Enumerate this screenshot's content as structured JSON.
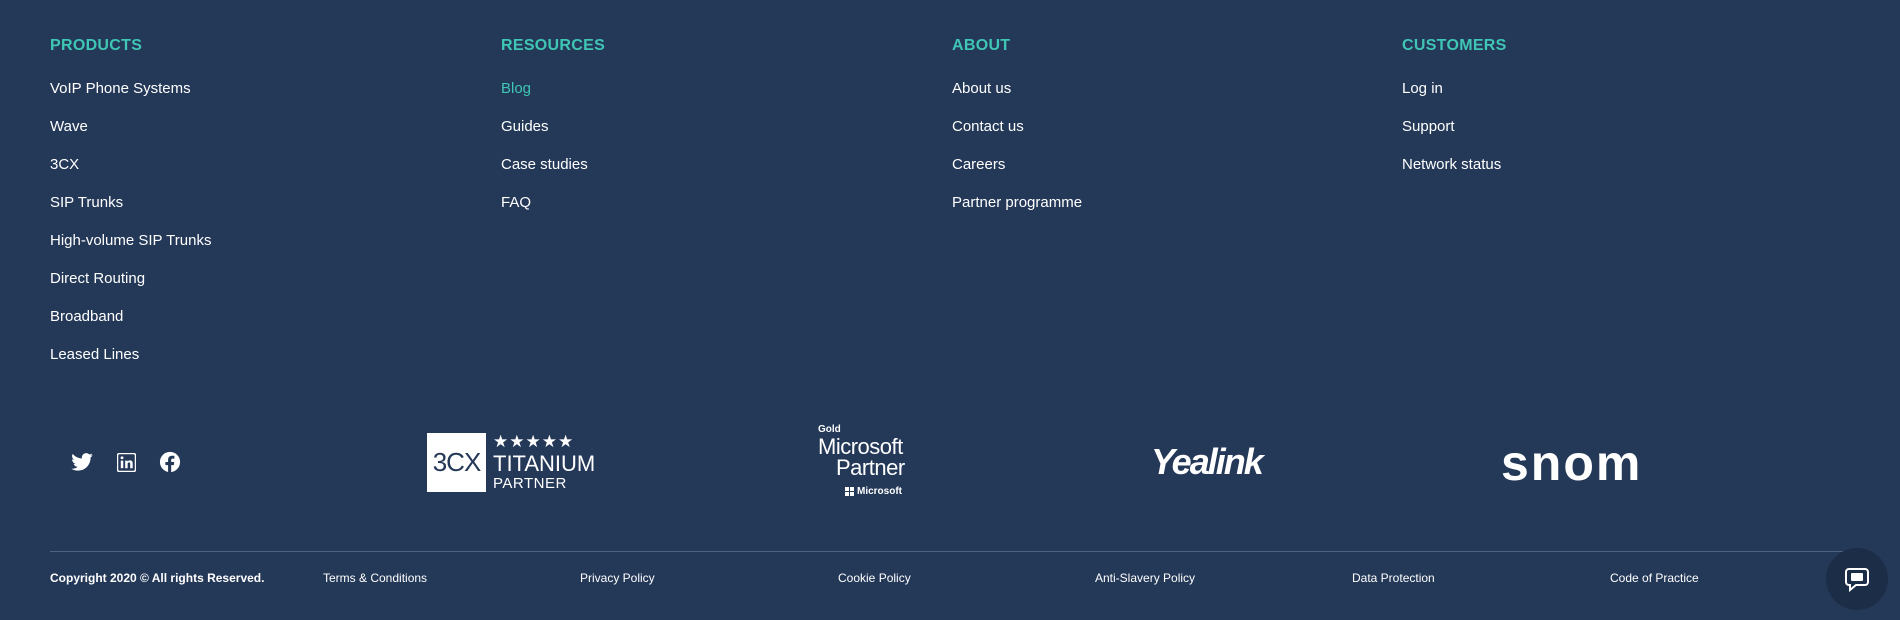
{
  "columns": [
    {
      "heading": "PRODUCTS",
      "links": [
        "VoIP Phone Systems",
        "Wave",
        "3CX",
        "SIP Trunks",
        "High-volume SIP Trunks",
        "Direct Routing",
        "Broadband",
        "Leased Lines"
      ]
    },
    {
      "heading": "RESOURCES",
      "links": [
        "Blog",
        "Guides",
        "Case studies",
        "FAQ"
      ]
    },
    {
      "heading": "ABOUT",
      "links": [
        "About us",
        "Contact us",
        "Careers",
        "Partner programme"
      ]
    },
    {
      "heading": "CUSTOMERS",
      "links": [
        "Log in",
        "Support",
        "Network status"
      ]
    }
  ],
  "social": {
    "icons": [
      "twitter-icon",
      "linkedin-icon",
      "facebook-icon"
    ]
  },
  "partners": {
    "threecx": {
      "logo_text": "3CX",
      "stars": "★★★★★",
      "line1": "TITANIUM",
      "line2": "PARTNER"
    },
    "microsoft": {
      "tier": "Gold",
      "line1": "Microsoft",
      "line2": "Partner",
      "line3": "Microsoft"
    },
    "yealink": "Yealink",
    "snom": "snom"
  },
  "footer": {
    "copyright": "Copyright 2020 © All rights Reserved.",
    "links": [
      "Terms & Conditions",
      "Privacy Policy",
      "Cookie Policy",
      "Anti-Slavery Policy",
      "Data Protection",
      "Code of Practice"
    ]
  },
  "colors": {
    "background": "#243858",
    "accent": "#3fc6b4",
    "divider": "#51627f"
  }
}
